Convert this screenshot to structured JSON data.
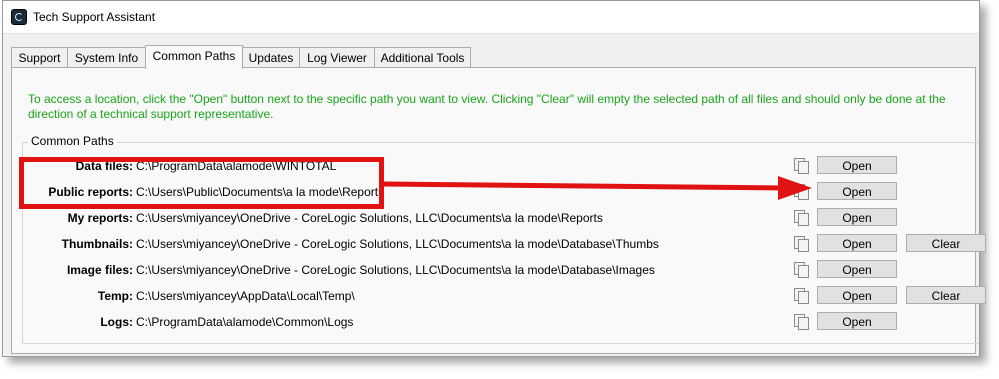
{
  "window": {
    "title": "Tech Support Assistant"
  },
  "tabs": [
    "Support",
    "System Info",
    "Common Paths",
    "Updates",
    "Log Viewer",
    "Additional Tools"
  ],
  "active_tab": "Common Paths",
  "instructions": "To access a location, click the \"Open\" button next to the specific path you want to view.  Clicking \"Clear\" will empty the selected path of all files and should only be done at the direction of a technical support representative.",
  "group": {
    "legend": "Common Paths",
    "rows": [
      {
        "label": "Data files:",
        "path": "C:\\ProgramData\\alamode\\WINTOTAL",
        "open": "Open"
      },
      {
        "label": "Public reports:",
        "path": "C:\\Users\\Public\\Documents\\a la mode\\Reports",
        "open": "Open"
      },
      {
        "label": "My reports:",
        "path": "C:\\Users\\miyancey\\OneDrive - CoreLogic Solutions, LLC\\Documents\\a la mode\\Reports",
        "open": "Open"
      },
      {
        "label": "Thumbnails:",
        "path": "C:\\Users\\miyancey\\OneDrive - CoreLogic Solutions, LLC\\Documents\\a la mode\\Database\\Thumbs",
        "open": "Open",
        "clear": "Clear"
      },
      {
        "label": "Image files:",
        "path": "C:\\Users\\miyancey\\OneDrive - CoreLogic Solutions, LLC\\Documents\\a la mode\\Database\\Images",
        "open": "Open"
      },
      {
        "label": "Temp:",
        "path": "C:\\Users\\miyancey\\AppData\\Local\\Temp\\",
        "open": "Open",
        "clear": "Clear"
      },
      {
        "label": "Logs:",
        "path": "C:\\ProgramData\\alamode\\Common\\Logs",
        "open": "Open"
      }
    ]
  },
  "annotation": {
    "color": "#e01212"
  }
}
